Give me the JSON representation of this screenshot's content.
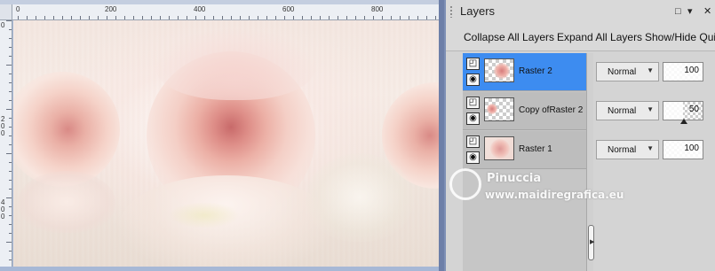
{
  "rulers": {
    "top_labels": [
      "0",
      "200",
      "400",
      "600",
      "800"
    ],
    "left_labels": [
      "0",
      "2",
      "0",
      "0",
      "4",
      "0",
      "0"
    ]
  },
  "layers_panel": {
    "title": "Layers",
    "title_buttons": {
      "restore": "□",
      "menu": "▾",
      "close": "✕"
    },
    "toolbar": {
      "collapse_all": "Collapse All Layers",
      "expand_all": "Expand All Layers",
      "show_hide": "Show/Hide Qui"
    },
    "layers": [
      {
        "name": "Raster 2",
        "blend_mode": "Normal",
        "opacity": 100,
        "selected": true
      },
      {
        "name": "Copy ofRaster 2",
        "blend_mode": "Normal",
        "opacity": 50,
        "selected": false
      },
      {
        "name": "Raster 1",
        "blend_mode": "Normal",
        "opacity": 100,
        "selected": false
      }
    ]
  },
  "icons": {
    "layer_type": "raster-layer-icon",
    "visibility": "eye-icon",
    "dropdown": "chevron-down-icon"
  },
  "watermark": {
    "name": "Pinuccia",
    "url": "www.maidiregrafica.eu"
  },
  "colors": {
    "selected_layer": "#3d8cf0",
    "layer_row": "#bdbdbd",
    "canvas_frame": "#a7b8d6"
  }
}
